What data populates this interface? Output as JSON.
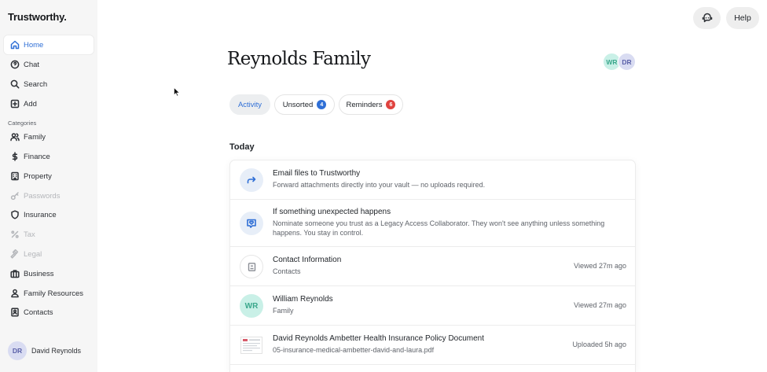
{
  "sidebar": {
    "logo": "Trustworthy.",
    "primary": [
      {
        "label": "Home",
        "icon": "home-icon",
        "active": true
      },
      {
        "label": "Chat",
        "icon": "chat-icon"
      },
      {
        "label": "Search",
        "icon": "search-icon"
      },
      {
        "label": "Add",
        "icon": "plus-square-icon"
      }
    ],
    "categories_label": "Categories",
    "categories": [
      {
        "label": "Family",
        "icon": "people-icon"
      },
      {
        "label": "Finance",
        "icon": "dollar-icon"
      },
      {
        "label": "Property",
        "icon": "building-icon"
      },
      {
        "label": "Passwords",
        "icon": "key-icon",
        "disabled": true
      },
      {
        "label": "Insurance",
        "icon": "shield-icon"
      },
      {
        "label": "Tax",
        "icon": "percent-icon",
        "disabled": true
      },
      {
        "label": "Legal",
        "icon": "gavel-icon",
        "disabled": true
      },
      {
        "label": "Business",
        "icon": "briefcase-icon"
      },
      {
        "label": "Family Resources",
        "icon": "person-group-icon"
      },
      {
        "label": "Contacts",
        "icon": "contact-card-icon"
      }
    ],
    "user": {
      "initials": "DR",
      "name": "David Reynolds"
    }
  },
  "topbar": {
    "assistant_icon": "chatbot-icon",
    "help_label": "Help"
  },
  "header": {
    "title": "Reynolds Family",
    "members": [
      {
        "initials": "WR",
        "color": "#c9f0e7"
      },
      {
        "initials": "DR",
        "color": "#d9dcf2"
      }
    ]
  },
  "tabs": [
    {
      "label": "Activity",
      "active": true
    },
    {
      "label": "Unsorted",
      "count": "4",
      "badge_color": "#2f6fd6"
    },
    {
      "label": "Reminders",
      "count": "6",
      "badge_color": "#e0433f"
    }
  ],
  "feed": {
    "heading": "Today",
    "items": [
      {
        "icon": "forward-arrow-icon",
        "title": "Email files to Trustworthy",
        "subtitle": "Forward attachments directly into your vault — no uploads required.",
        "meta": ""
      },
      {
        "icon": "heart-message-icon",
        "title": "If something unexpected happens",
        "subtitle": "Nominate someone you trust as a Legacy Access Collaborator. They won't see anything unless something happens. You stay in control.",
        "meta": ""
      },
      {
        "icon": "contact-card-icon",
        "title": "Contact Information",
        "subtitle": "Contacts",
        "meta": "Viewed 27m ago"
      },
      {
        "icon": "avatar",
        "initials": "WR",
        "title": "William Reynolds",
        "subtitle": "Family",
        "meta": "Viewed 27m ago"
      },
      {
        "icon": "document-thumbnail",
        "title": "David Reynolds Ambetter Health Insurance Policy Document",
        "subtitle": "05-insurance-medical-ambetter-david-and-laura.pdf",
        "meta": "Uploaded 5h ago"
      }
    ]
  },
  "colors": {
    "accent": "#2f6fd6",
    "sidebar_bg": "#f6f6f6",
    "danger": "#e0433f"
  }
}
